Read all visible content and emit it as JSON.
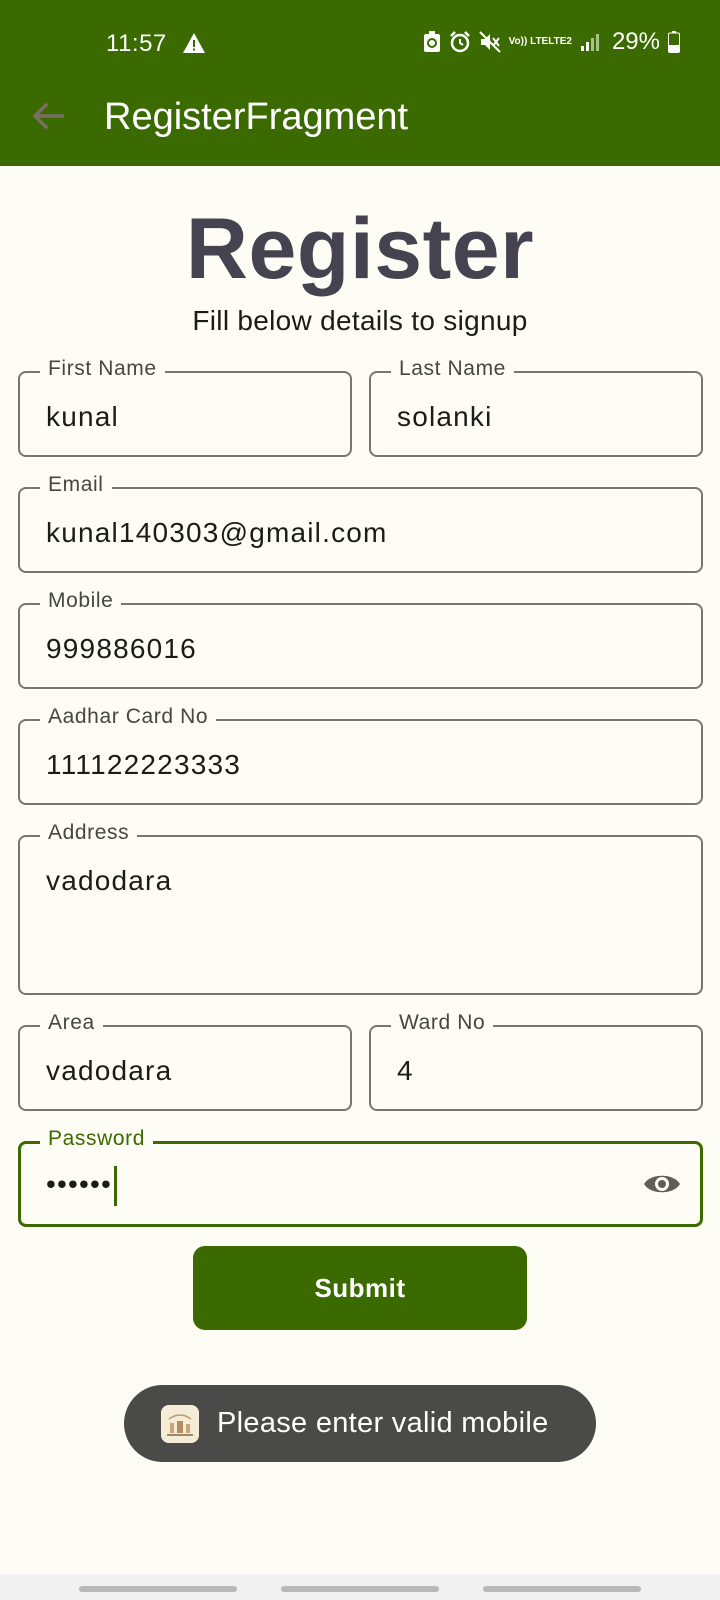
{
  "status_bar": {
    "time": "11:57",
    "network_top": "Vo)) LTE",
    "network_bottom": "LTE2",
    "battery": "29%"
  },
  "app_bar": {
    "title": "RegisterFragment",
    "back_icon": "arrow-back-icon"
  },
  "page": {
    "heading": "Register",
    "subheading": "Fill below details to signup"
  },
  "form": {
    "first_name": {
      "label": "First Name",
      "value": "kunal"
    },
    "last_name": {
      "label": "Last Name",
      "value": "solanki"
    },
    "email": {
      "label": "Email",
      "value": "kunal140303@gmail.com"
    },
    "mobile": {
      "label": "Mobile",
      "value": "999886016"
    },
    "aadhar": {
      "label": "Aadhar Card No",
      "value": "111122223333"
    },
    "address": {
      "label": "Address",
      "value": "vadodara"
    },
    "area": {
      "label": "Area",
      "value": "vadodara"
    },
    "ward": {
      "label": "Ward No",
      "value": "4"
    },
    "password": {
      "label": "Password",
      "value": "••••••",
      "toggle_icon": "eye-icon"
    }
  },
  "submit_label": "Submit",
  "toast": {
    "message": "Please enter valid mobile"
  },
  "colors": {
    "primary": "#3b6a00",
    "background": "#fdfcf5",
    "heading": "#45434f",
    "outline": "#75786c",
    "toast_bg": "#4a4a48"
  }
}
